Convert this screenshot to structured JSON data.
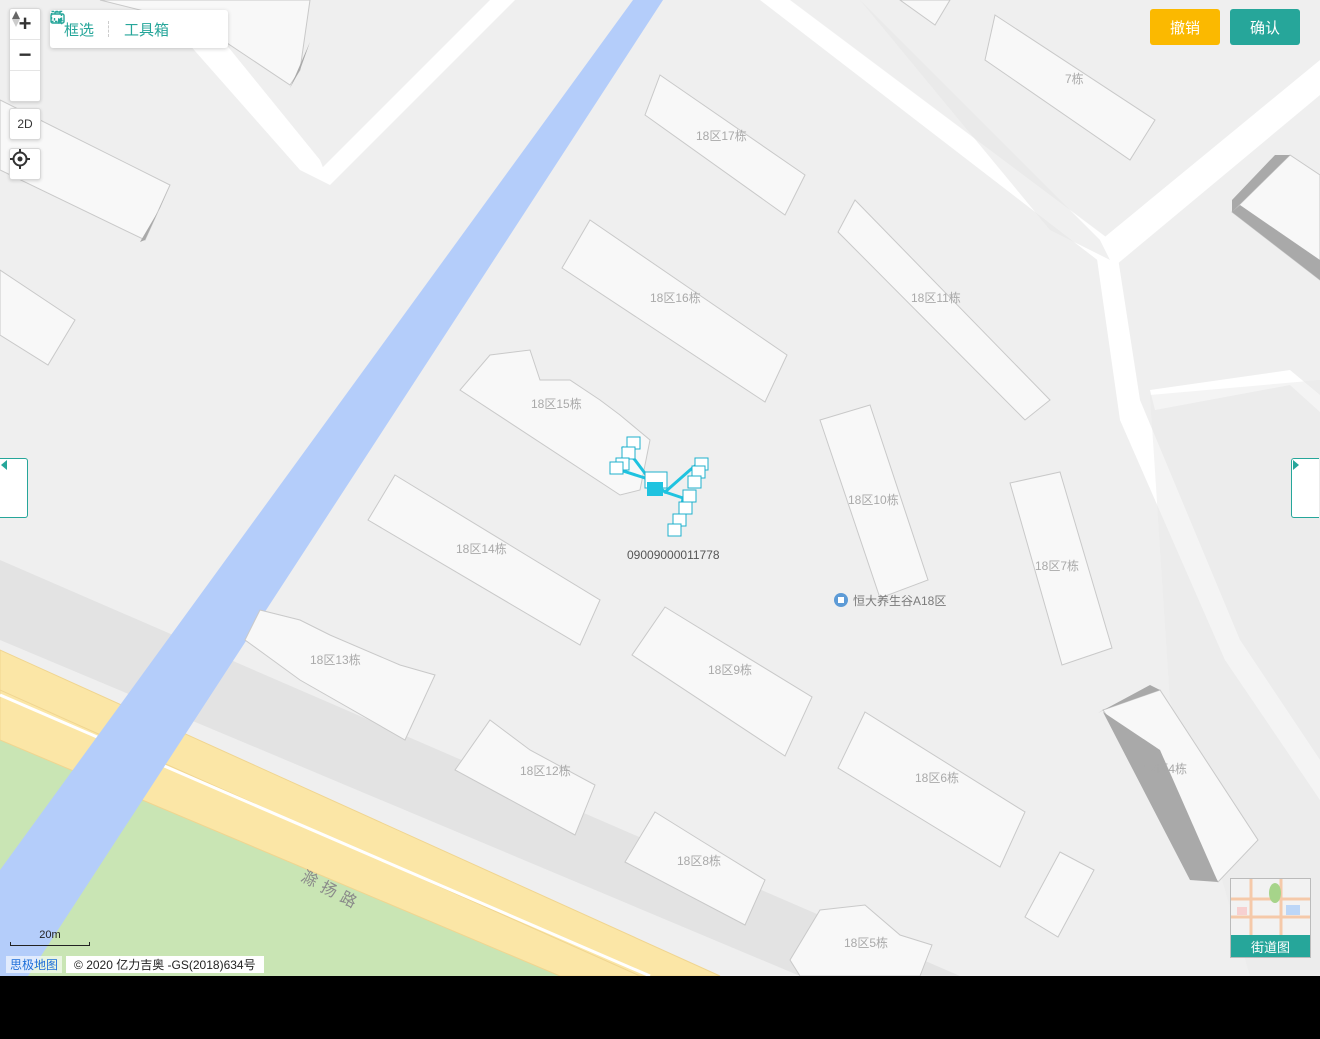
{
  "map": {
    "zoom_in": "+",
    "zoom_out": "−",
    "mode_2d": "2D",
    "toolbar": {
      "select_label": "框选",
      "toolbox_label": "工具箱"
    },
    "actions": {
      "undo_label": "撤销",
      "confirm_label": "确认"
    },
    "accent_color": "#26a69a",
    "undo_color": "#fbb900",
    "buildings": [
      "18区17栋",
      "18区16栋",
      "18区11栋",
      "18区15栋",
      "18区10栋",
      "18区14栋",
      "18区7栋",
      "18区13栋",
      "18区9栋",
      "18区12栋",
      "18区6栋",
      "18区4栋",
      "18区8栋",
      "18区5栋",
      "7栋"
    ],
    "poi": {
      "name": "恒大养生谷A18区",
      "icon": "poi-pin-icon"
    },
    "road_name": "滁扬路",
    "device_id": "09009000011778",
    "scale_label": "20m",
    "attribution": {
      "logo": "思极地图",
      "copyright": "© 2020 亿力吉奥 -GS(2018)634号"
    },
    "minimap_label": "街道图"
  }
}
